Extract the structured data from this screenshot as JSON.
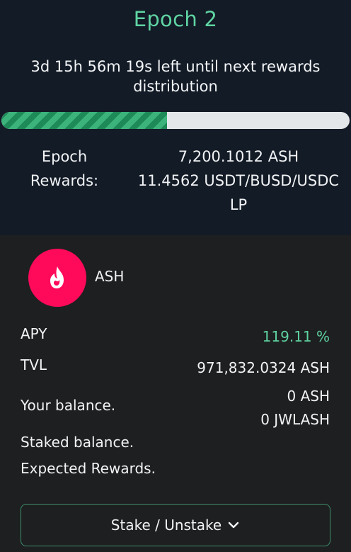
{
  "epoch": {
    "title": "Epoch 2",
    "countdown": "3d 15h 56m 19s left until next rewards distribution",
    "progress_percent": 47.5,
    "rewards_label": "Epoch Rewards:",
    "rewards_values": [
      "7,200.1012 ASH",
      "11.4562 USDT/BUSD/USDC LP"
    ]
  },
  "pool": {
    "token_name": "ASH",
    "token_icon": "flame-icon",
    "token_color": "#ff0a5a",
    "apy_label": "APY",
    "apy_value": "119.11 %",
    "tvl_label": "TVL",
    "tvl_value": "971,832.0324 ASH",
    "balance_label": "Your balance.",
    "balance_values": [
      "0 ASH",
      "0 JWLASH"
    ],
    "staked_label": "Staked balance.",
    "rewards_label": "Expected Rewards.",
    "stake_button_label": "Stake / Unstake"
  },
  "colors": {
    "accent": "#5fd4a3",
    "header_bg": "#131b26",
    "body_bg": "#1e1f20"
  }
}
